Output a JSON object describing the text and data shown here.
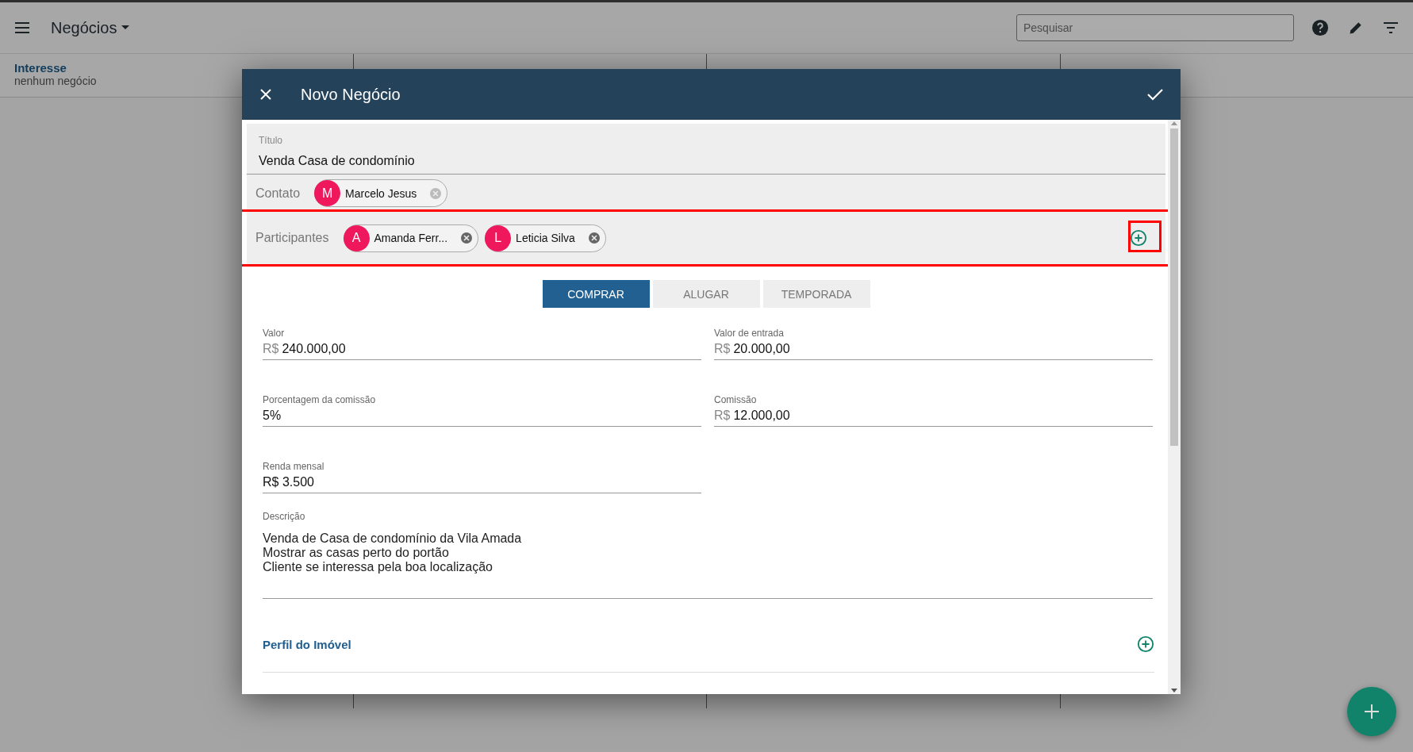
{
  "app_bar": {
    "title": "Negócios",
    "search": {
      "placeholder": "Pesquisar"
    }
  },
  "stages": [
    {
      "title": "Interesse",
      "subtitle": "nenhum negócio"
    }
  ],
  "dialog": {
    "title": "Novo Negócio",
    "title_field": {
      "label": "Título",
      "value": "Venda Casa de condomínio"
    },
    "contact": {
      "label": "Contato",
      "chips": [
        {
          "initial": "M",
          "name": "Marcelo Jesus"
        }
      ]
    },
    "participants": {
      "label": "Participantes",
      "highlighted": true,
      "chips": [
        {
          "initial": "A",
          "name": "Amanda Ferr..."
        },
        {
          "initial": "L",
          "name": "Leticia Silva"
        }
      ]
    },
    "modes": [
      {
        "label": "COMPRAR",
        "selected": true
      },
      {
        "label": "ALUGAR",
        "selected": false
      },
      {
        "label": "TEMPORADA",
        "selected": false
      }
    ],
    "fields": [
      {
        "label": "Valor",
        "prefix": "R$",
        "value": "240.000,00"
      },
      {
        "label": "Valor de entrada",
        "prefix": "R$",
        "value": "20.000,00"
      },
      {
        "label": "Porcentagem da comissão",
        "value": "5%"
      },
      {
        "label": "Comissão",
        "prefix": "R$",
        "value": "12.000,00"
      },
      {
        "label": "Renda mensal",
        "value": "R$ 3.500"
      }
    ],
    "description": {
      "label": "Descrição",
      "value": "Venda de Casa de condomínio da Vila Amada\nMostrar as casas perto do portão\nCliente se interessa pela boa localização"
    },
    "section": {
      "title": "Perfil do Imóvel"
    }
  }
}
